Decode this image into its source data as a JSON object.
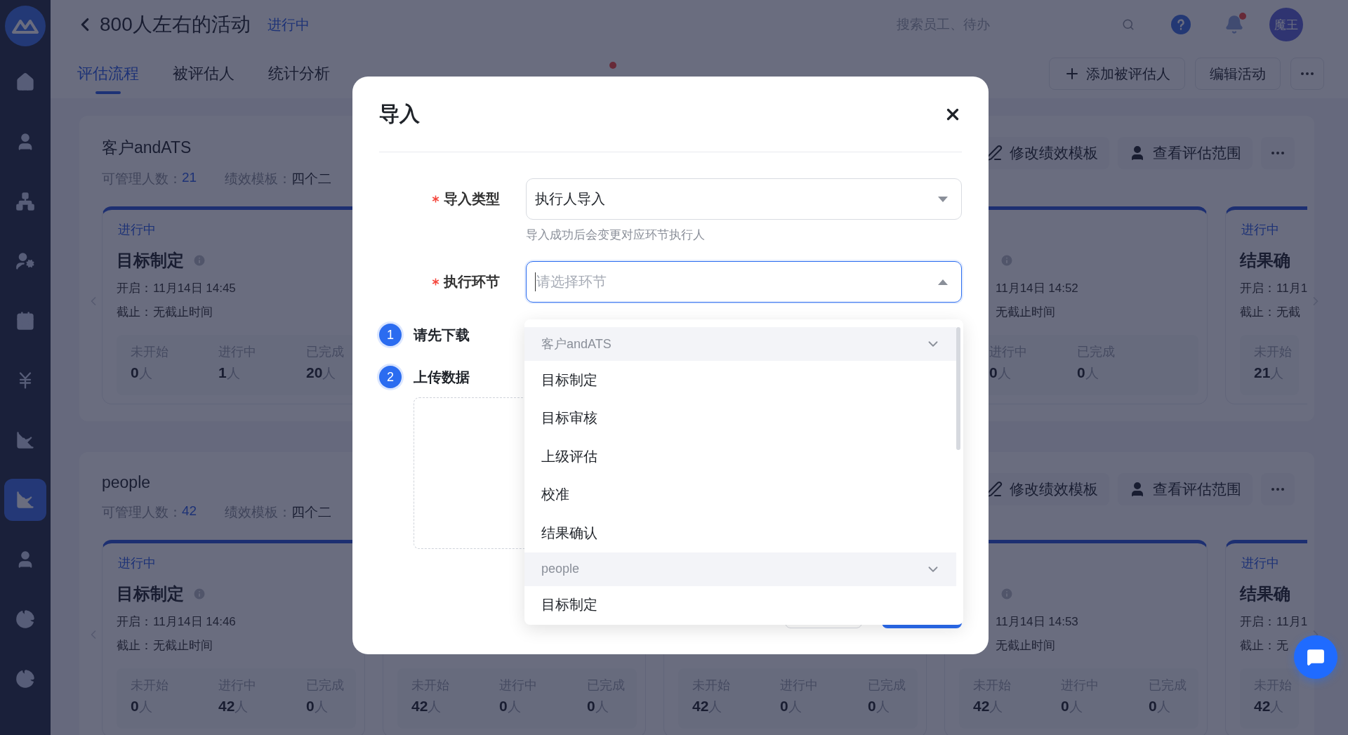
{
  "sidebar": {
    "items": [
      {
        "kind": "home",
        "selected": false
      },
      {
        "kind": "user",
        "selected": false
      },
      {
        "kind": "org",
        "selected": false
      },
      {
        "kind": "user-gear",
        "selected": false
      },
      {
        "kind": "calendar",
        "selected": false
      },
      {
        "kind": "yen",
        "selected": false
      },
      {
        "kind": "chart",
        "selected": false
      },
      {
        "kind": "chart",
        "selected": true
      },
      {
        "kind": "user",
        "selected": false
      },
      {
        "kind": "pie",
        "selected": false
      },
      {
        "kind": "pie",
        "selected": false
      }
    ]
  },
  "header": {
    "title": "800人左右的活动",
    "status": "进行中",
    "search": {
      "placeholder": "搜索员工、待办"
    },
    "notification": true,
    "avatar": "魔王"
  },
  "tabs": [
    {
      "label": "评估流程",
      "selected": true,
      "dot": false
    },
    {
      "label": "被评估人",
      "selected": false,
      "dot": false
    },
    {
      "label": "统计分析",
      "selected": false,
      "dot": false
    }
  ],
  "hidden_tab_dot": true,
  "page_actions": [
    {
      "label": "添加被评估人",
      "kind": "add"
    },
    {
      "label": "编辑活动",
      "kind": "plain"
    }
  ],
  "sections": [
    {
      "title": "客户andATS",
      "managed_label": "可管理人数：",
      "managed_count": "21",
      "template_label": "绩效模板：",
      "template_value": "四个二",
      "actions": [
        {
          "label": "修改绩效模板",
          "kind": "edit"
        },
        {
          "label": "查看评估范围",
          "kind": "person"
        }
      ],
      "cards_left": [
        {
          "status": "进行中",
          "title": "目标制定",
          "info": true,
          "start_label": "开启：",
          "start": "11月14日 14:45",
          "end_label": "截止：",
          "end": "无截止时间",
          "stats": [
            {
              "label": "未开始",
              "count": "0",
              "unit": "人"
            },
            {
              "label": "进行中",
              "count": "1",
              "unit": "人"
            },
            {
              "label": "已完成",
              "count": "20",
              "unit": "人"
            }
          ]
        }
      ],
      "cards_right": [
        {
          "info": true,
          "start": "11月14日 14:52",
          "end": "无截止时间",
          "stats": [
            {
              "label": "进行中",
              "count": "0",
              "unit": "人"
            },
            {
              "label": "已完成",
              "count": "0",
              "unit": "人"
            }
          ]
        },
        {
          "status": "进行中",
          "title": "结果确",
          "start_label": "开启：",
          "start": "11月1",
          "end_label": "截止：",
          "end": "无截",
          "stats": [
            {
              "label": "未开始",
              "count": "21",
              "unit": "人"
            }
          ]
        }
      ]
    },
    {
      "title": "people",
      "managed_label": "可管理人数：",
      "managed_count": "42",
      "template_label": "绩效模板：",
      "template_value": "四个二",
      "actions": [
        {
          "label": "修改绩效模板",
          "kind": "edit"
        },
        {
          "label": "查看评估范围",
          "kind": "person"
        }
      ],
      "cards_left": [
        {
          "status": "进行中",
          "title": "目标制定",
          "info": true,
          "start_label": "开启：",
          "start": "11月14日 14:46",
          "end_label": "截止：",
          "end": "无截止时间",
          "stats": [
            {
              "label": "未开始",
              "count": "0",
              "unit": "人"
            },
            {
              "label": "进行中",
              "count": "42",
              "unit": "人"
            },
            {
              "label": "已完成",
              "count": "0",
              "unit": "人"
            }
          ]
        },
        {
          "stats": [
            {
              "label": "未开始",
              "count": "42",
              "unit": "人"
            },
            {
              "label": "进行中",
              "count": "0",
              "unit": "人"
            },
            {
              "label": "已完成",
              "count": "0",
              "unit": "人"
            }
          ]
        },
        {
          "stats": [
            {
              "label": "未开始",
              "count": "42",
              "unit": "人"
            },
            {
              "label": "进行中",
              "count": "0",
              "unit": "人"
            },
            {
              "label": "已完成",
              "count": "0",
              "unit": "人"
            }
          ]
        }
      ],
      "cards_right": [
        {
          "info": true,
          "start": "11月14日 14:53",
          "end": "无截止时间",
          "stats": [
            {
              "label": "未开始",
              "count": "42",
              "unit": "人"
            },
            {
              "label": "进行中",
              "count": "0",
              "unit": "人"
            },
            {
              "label": "已完成",
              "count": "0",
              "unit": "人"
            }
          ]
        },
        {
          "status": "进行中",
          "title": "结果确",
          "start_label": "开启：",
          "start": "11月1",
          "end_label": "截止：",
          "end": "无",
          "stats": [
            {
              "label": "未开始",
              "count": "42",
              "unit": "人"
            }
          ]
        }
      ]
    }
  ],
  "modal": {
    "title": "导入",
    "fields": [
      {
        "label": "导入类型",
        "required": true,
        "value": "执行人导入",
        "hint": "导入成功后会变更对应环节执行人",
        "focused": false,
        "open": false
      },
      {
        "label": "执行环节",
        "required": true,
        "placeholder": "请选择环节",
        "focused": true,
        "open": true
      }
    ],
    "steps": [
      {
        "number": "1",
        "label": "请先下载"
      },
      {
        "number": "2",
        "label": "上传数据"
      }
    ],
    "dropdown": {
      "groups": [
        {
          "name": "客户andATS",
          "expanded": true,
          "options": [
            "目标制定",
            "目标审核",
            "上级评估",
            "校准",
            "结果确认"
          ]
        },
        {
          "name": "people",
          "expanded": true,
          "options": [
            "目标制定"
          ]
        }
      ]
    }
  }
}
